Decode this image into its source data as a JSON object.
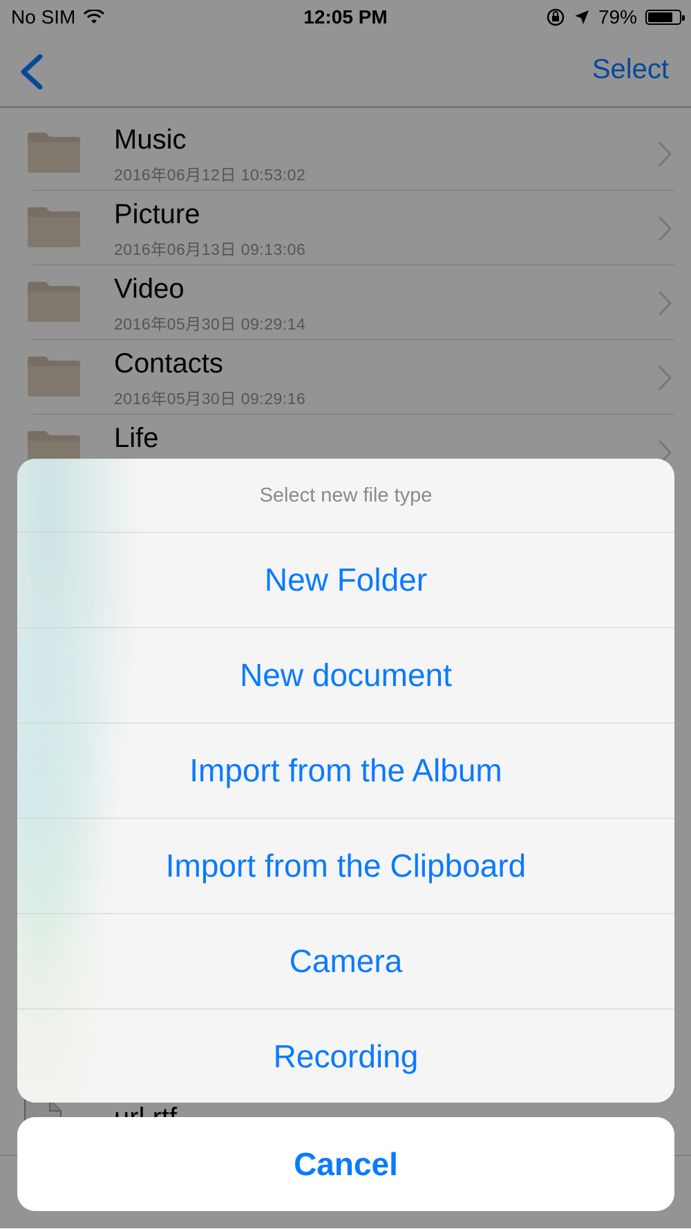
{
  "status_bar": {
    "carrier": "No SIM",
    "time": "12:05 PM",
    "battery_percent": "79%",
    "battery_level": 0.79,
    "icons": [
      "wifi-icon",
      "orientation-lock-icon",
      "location-arrow-icon",
      "battery-icon"
    ]
  },
  "nav_bar": {
    "back_icon": "chevron-left-icon",
    "select_label": "Select"
  },
  "files": [
    {
      "name": "Music",
      "date": "2016年06月12日 10:53:02"
    },
    {
      "name": "Picture",
      "date": "2016年06月13日 09:13:06"
    },
    {
      "name": "Video",
      "date": "2016年05月30日 09:29:14"
    },
    {
      "name": "Contacts",
      "date": "2016年05月30日 09:29:16"
    },
    {
      "name": "Life",
      "date": ""
    }
  ],
  "partial_file": {
    "name": "url.rtf"
  },
  "action_sheet": {
    "title": "Select new file type",
    "options": [
      "New Folder",
      "New document",
      "Import from the Album",
      "Import from the Clipboard",
      "Camera",
      "Recording"
    ],
    "cancel_label": "Cancel"
  },
  "colors": {
    "accent": "#0a7aff",
    "folder": "#c9b9a3",
    "overlay": "rgba(0,0,0,0.40)"
  }
}
